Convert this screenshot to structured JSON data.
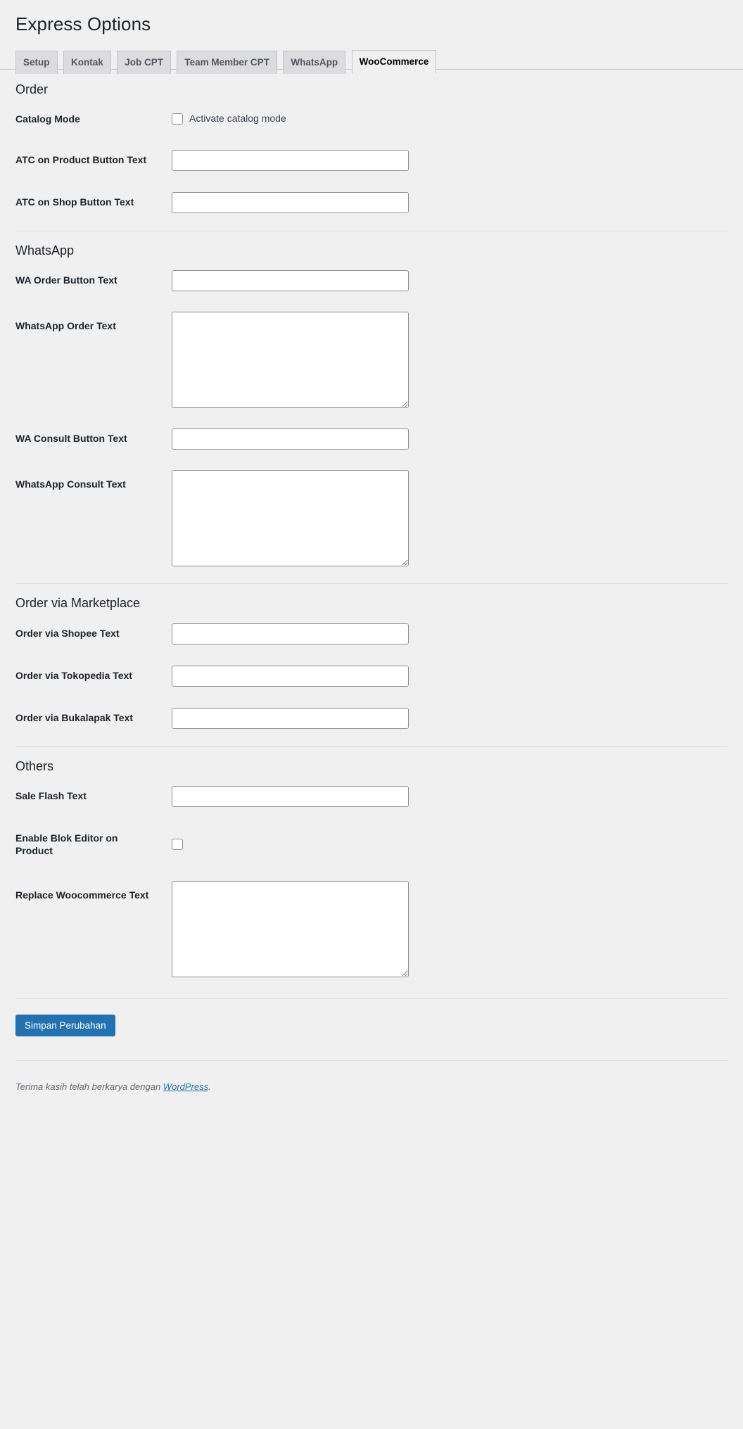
{
  "page": {
    "title": "Express Options"
  },
  "tabs": [
    {
      "label": "Setup",
      "active": false
    },
    {
      "label": "Kontak",
      "active": false
    },
    {
      "label": "Job CPT",
      "active": false
    },
    {
      "label": "Team Member CPT",
      "active": false
    },
    {
      "label": "WhatsApp",
      "active": false
    },
    {
      "label": "WooCommerce",
      "active": true
    }
  ],
  "sections": {
    "order": {
      "heading": "Order",
      "fields": {
        "catalog_mode": {
          "label": "Catalog Mode",
          "checkbox_label": "Activate catalog mode",
          "checked": false
        },
        "atc_product": {
          "label": "ATC on Product Button Text",
          "value": "",
          "placeholder": ""
        },
        "atc_shop": {
          "label": "ATC on Shop Button Text",
          "value": "",
          "placeholder": ""
        }
      }
    },
    "whatsapp": {
      "heading": "WhatsApp",
      "fields": {
        "wa_order_button": {
          "label": "WA Order Button Text",
          "value": "",
          "placeholder": ""
        },
        "wa_order_text": {
          "label": "WhatsApp Order Text",
          "value": "",
          "placeholder": ""
        },
        "wa_consult_button": {
          "label": "WA Consult Button Text",
          "value": "",
          "placeholder": ""
        },
        "wa_consult_text": {
          "label": "WhatsApp Consult Text",
          "value": "",
          "placeholder": ""
        }
      }
    },
    "marketplace": {
      "heading": "Order via Marketplace",
      "fields": {
        "shopee": {
          "label": "Order via Shopee Text",
          "value": "",
          "placeholder": ""
        },
        "tokopedia": {
          "label": "Order via Tokopedia Text",
          "value": "",
          "placeholder": ""
        },
        "bukalapak": {
          "label": "Order via Bukalapak Text",
          "value": "",
          "placeholder": ""
        }
      }
    },
    "others": {
      "heading": "Others",
      "fields": {
        "sale_flash": {
          "label": "Sale Flash Text",
          "value": "",
          "placeholder": ""
        },
        "blok_editor": {
          "label": "Enable Blok Editor on Product",
          "checkbox_label": "",
          "checked": false
        },
        "replace_woo_text": {
          "label": "Replace Woocommerce Text",
          "value": "",
          "placeholder": ""
        }
      }
    }
  },
  "submit": {
    "label": "Simpan Perubahan"
  },
  "footer": {
    "text_before": "Terima kasih telah berkarya dengan ",
    "link_label": "WordPress",
    "text_after": "."
  },
  "colors": {
    "accent": "#2271b1",
    "page_bg": "#f0f0f1",
    "tab_inactive_bg": "#dcdcde",
    "border": "#c3c4c7",
    "input_border": "#8c8f94"
  }
}
